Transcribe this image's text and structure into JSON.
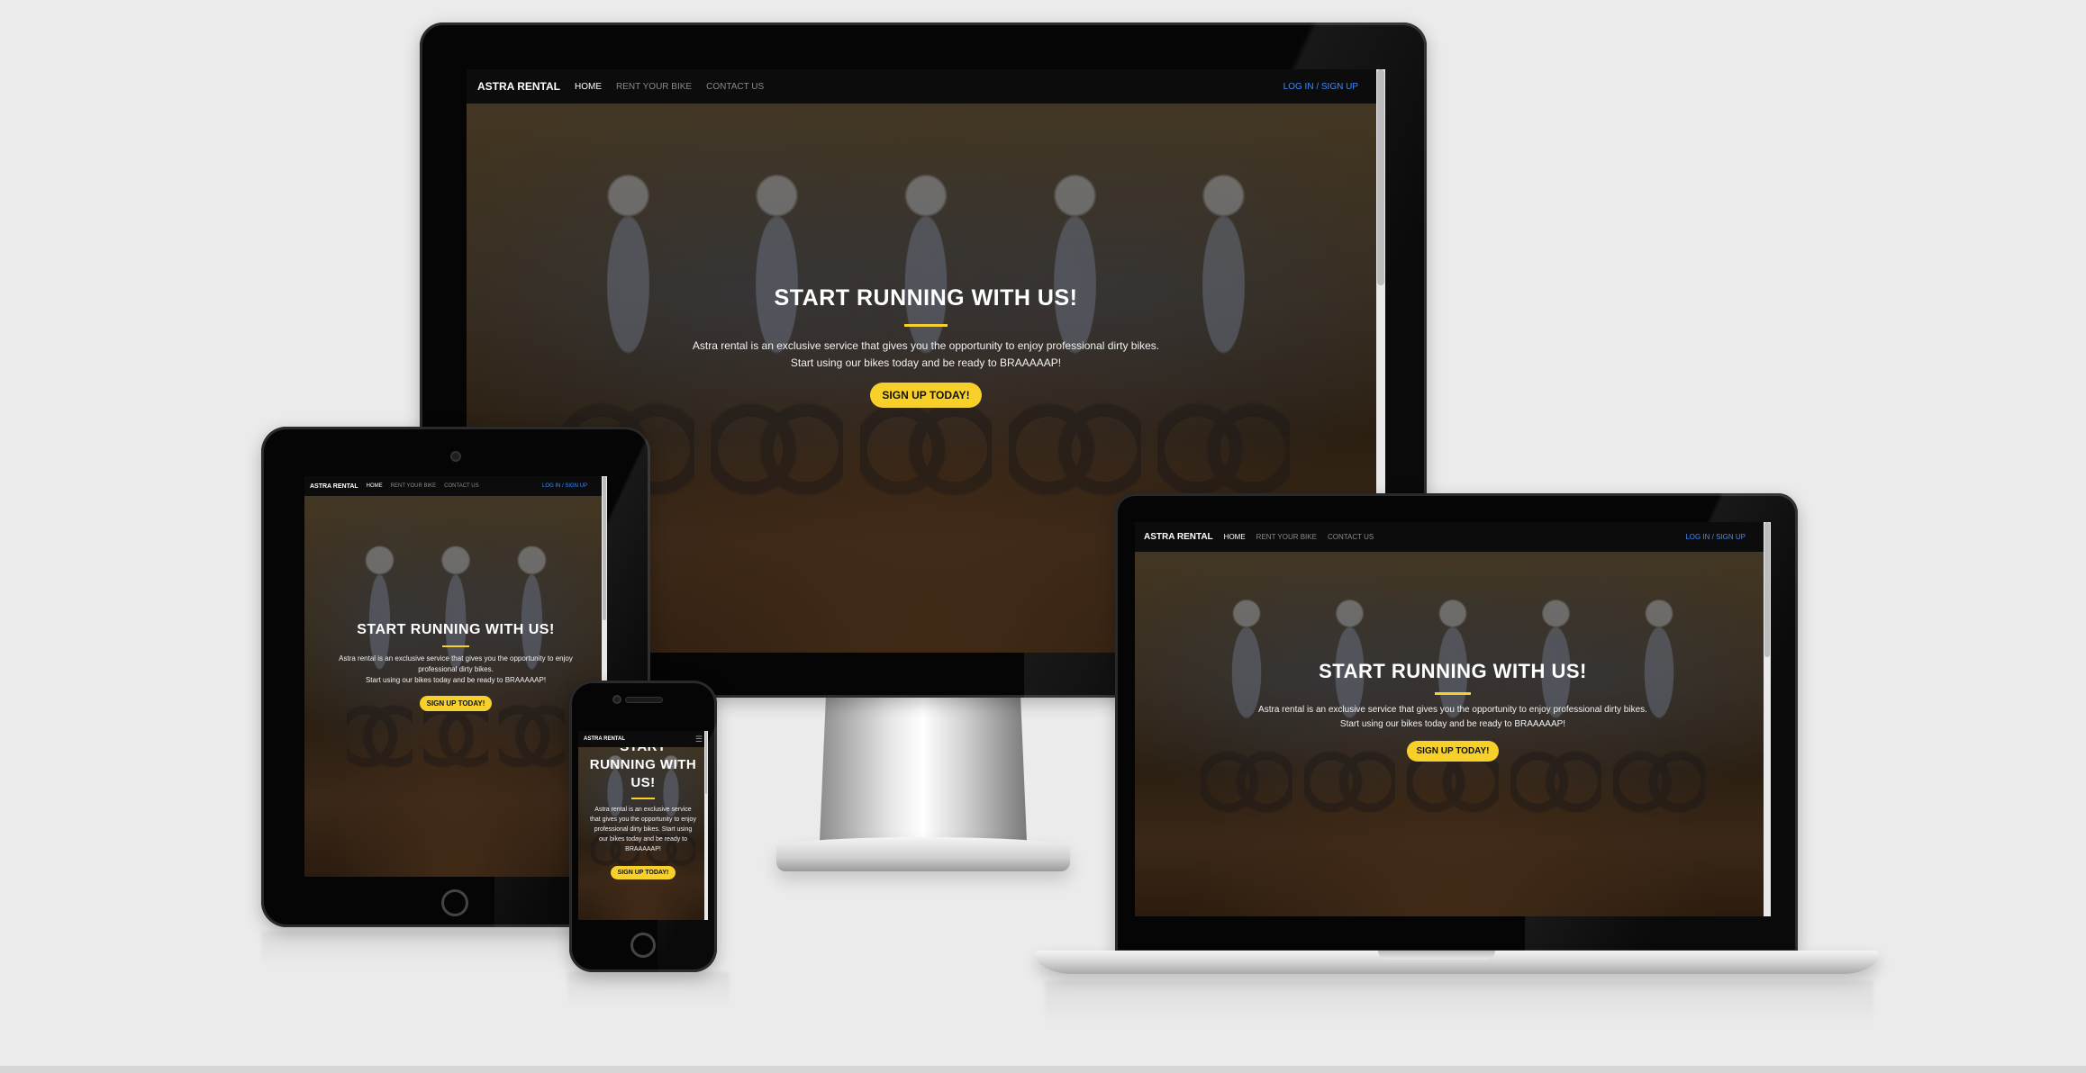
{
  "site": {
    "brand": "ASTRA RENTAL",
    "nav": {
      "home": "HOME",
      "rent": "RENT YOUR BIKE",
      "contact": "CONTACT US",
      "login": "LOG IN / SIGN UP"
    },
    "hero": {
      "title": "START RUNNING WITH US!",
      "line1": "Astra rental is an exclusive service that gives you the opportunity to enjoy professional dirty bikes.",
      "line2": "Start using our bikes today and be ready to BRAAAAAP!",
      "cta": "SIGN UP TODAY!"
    },
    "phone_hero": {
      "title": "START RUNNING WITH US!",
      "text": "Astra rental is an exclusive service that gives you the opportunity to enjoy professional dirty bikes. Start using our bikes today and be ready to BRAAAAAP!"
    }
  },
  "devices": {
    "monitor": "desktop-monitor",
    "laptop": "laptop",
    "tablet": "tablet",
    "phone": "smartphone"
  },
  "colors": {
    "accent": "#f7d12a",
    "link": "#3d8bff",
    "navbar": "#0c0c0c",
    "bezel": "#050505"
  },
  "icons": {
    "phone_menu": "hamburger-menu-icon"
  }
}
